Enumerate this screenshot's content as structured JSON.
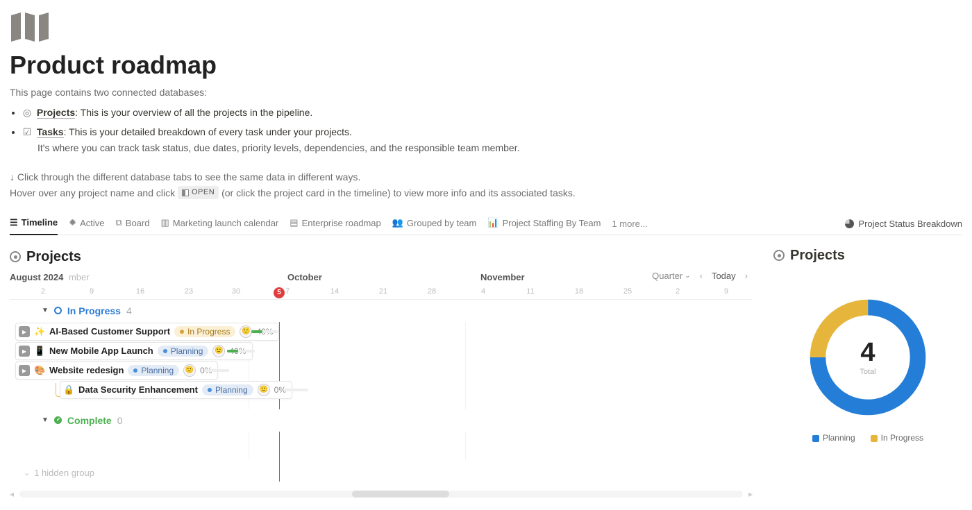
{
  "page": {
    "title": "Product roadmap",
    "intro": "This page contains two connected databases:",
    "bullets": [
      {
        "link": "Projects",
        "after_link": ": This is your overview of all the projects in the pipeline.",
        "sub": ""
      },
      {
        "link": "Tasks",
        "after_link": ": This is your detailed breakdown of every task under your projects.",
        "sub": "It's where you can track task status, due dates, priority levels, dependencies, and the responsible team member."
      }
    ],
    "hint_line1": "↓ Click through the different database tabs to see the same data in different ways.",
    "hint_prefix": "Hover over any project name and click ",
    "open_label": "OPEN",
    "hint_suffix": " (or click the project card in the timeline) to view more info and its associated tasks."
  },
  "tabs": {
    "items": [
      {
        "label": "Timeline",
        "active": true
      },
      {
        "label": "Active"
      },
      {
        "label": "Board"
      },
      {
        "label": "Marketing launch calendar"
      },
      {
        "label": "Enterprise roadmap"
      },
      {
        "label": "Grouped by team"
      },
      {
        "label": "Project Staffing By Team"
      }
    ],
    "more": "1 more...",
    "right_view": "Project Status Breakdown"
  },
  "timeline": {
    "section_title": "Projects",
    "months": {
      "aug": "August 2024",
      "aug_suffix": "mber",
      "oct": "October",
      "nov": "November"
    },
    "controls": {
      "scale": "Quarter",
      "today": "Today"
    },
    "today_day": "5",
    "days": [
      "2",
      "9",
      "16",
      "23",
      "30",
      "7",
      "14",
      "21",
      "28",
      "4",
      "11",
      "18",
      "25",
      "2",
      "9"
    ],
    "groups": {
      "in_progress": {
        "label": "In Progress",
        "count": "4"
      },
      "complete": {
        "label": "Complete",
        "count": "0"
      }
    },
    "projects": [
      {
        "emoji": "✨",
        "name": "AI-Based Customer Support",
        "status": "In Progress",
        "status_class": "inprogress",
        "pct": "40%",
        "has_expand": true
      },
      {
        "emoji": "📱",
        "name": "New Mobile App Launch",
        "status": "Planning",
        "status_class": "planning",
        "pct": "40%",
        "has_expand": true
      },
      {
        "emoji": "🎨",
        "name": "Website redesign",
        "status": "Planning",
        "status_class": "planning",
        "pct": "0%",
        "has_expand": true
      },
      {
        "emoji": "🔒",
        "name": "Data Security Enhancement",
        "status": "Planning",
        "status_class": "planning",
        "pct": "0%",
        "has_expand": false,
        "nested": true
      }
    ],
    "hidden_group": "1 hidden group"
  },
  "sidebar": {
    "title": "Projects",
    "total": "4",
    "total_label": "Total",
    "legend": {
      "planning": "Planning",
      "inprogress": "In Progress"
    }
  },
  "chart_data": {
    "type": "pie",
    "title": "Project Status Breakdown",
    "total": 4,
    "series": [
      {
        "name": "Planning",
        "value": 3,
        "color": "#247dd6"
      },
      {
        "name": "In Progress",
        "value": 1,
        "color": "#e6b63c"
      }
    ]
  }
}
